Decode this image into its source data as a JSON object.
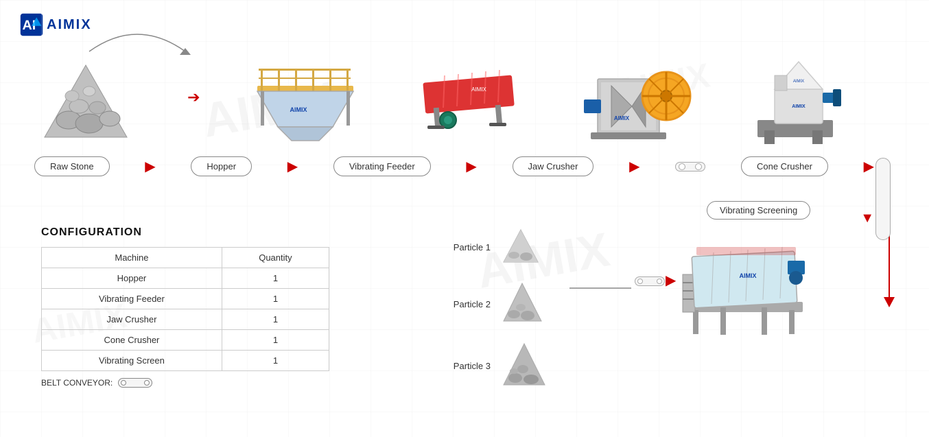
{
  "logo": {
    "text": "AIMIX"
  },
  "flow": {
    "stages": [
      {
        "id": "raw-stone",
        "label": "Raw Stone"
      },
      {
        "id": "hopper",
        "label": "Hopper"
      },
      {
        "id": "vibrating-feeder",
        "label": "Vibrating Feeder"
      },
      {
        "id": "jaw-crusher",
        "label": "Jaw Crusher"
      },
      {
        "id": "cone-crusher",
        "label": "Cone Crusher"
      }
    ]
  },
  "configuration": {
    "title": "CONFIGURATION",
    "columns": [
      "Machine",
      "Quantity"
    ],
    "rows": [
      {
        "machine": "Hopper",
        "quantity": "1"
      },
      {
        "machine": "Vibrating Feeder",
        "quantity": "1"
      },
      {
        "machine": "Jaw Crusher",
        "quantity": "1"
      },
      {
        "machine": "Cone Crusher",
        "quantity": "1"
      },
      {
        "machine": "Vibrating Screen",
        "quantity": "1"
      }
    ]
  },
  "belt_conveyor": {
    "label": "BELT CONVEYOR:"
  },
  "output": {
    "particles": [
      {
        "id": "particle-1",
        "label": "Particle 1"
      },
      {
        "id": "particle-2",
        "label": "Particle 2"
      },
      {
        "id": "particle-3",
        "label": "Particle 3"
      }
    ],
    "vibrating_screening_label": "Vibrating Screening"
  }
}
